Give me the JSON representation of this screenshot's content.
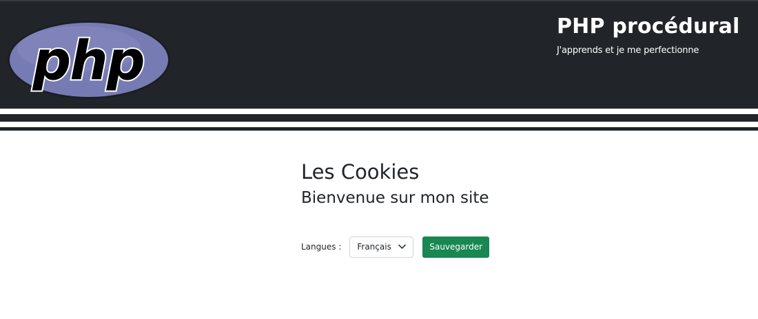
{
  "header": {
    "logo_text": "php",
    "title": "PHP procédural",
    "subtitle": "J'apprends et je me perfectionne"
  },
  "main": {
    "heading": "Les Cookies",
    "subheading": "Bienvenue sur mon site"
  },
  "form": {
    "languages_label": "Langues :",
    "language_selected": "Français",
    "save_label": "Sauvegarder"
  },
  "colors": {
    "header_bg": "#212529",
    "logo_oval": "#777bb3",
    "save_button": "#198754"
  },
  "icons": {
    "logo": "php-logo",
    "select_caret": "chevron-down-icon"
  }
}
